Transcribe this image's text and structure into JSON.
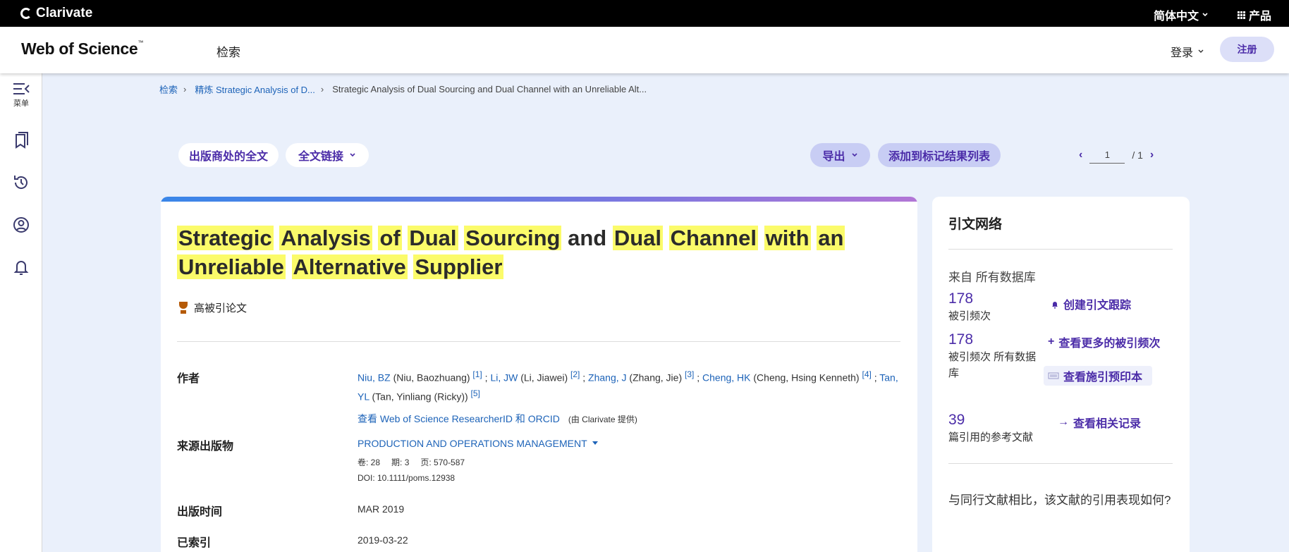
{
  "topbar": {
    "brand": "Clarivate",
    "language": "简体中文",
    "products": "产品"
  },
  "header": {
    "logo": "Web of Science",
    "logo_tm": "™",
    "nav_search": "检索",
    "login": "登录",
    "register": "注册"
  },
  "sidebar": {
    "menu_caption": "菜单"
  },
  "breadcrumb": {
    "search": "检索",
    "refine_prefix": "精炼",
    "refine_text": "Strategic Analysis of D...",
    "current": "Strategic Analysis of Dual Sourcing and Dual Channel with an Unreliable Alt..."
  },
  "actions": {
    "publisher_fulltext": "出版商处的全文",
    "fulltext_links": "全文链接",
    "export": "导出",
    "add_to_marked": "添加到标记结果列表"
  },
  "pager": {
    "current": "1",
    "total": "/ 1"
  },
  "record": {
    "title_words": [
      {
        "text": "Strategic",
        "hl": true
      },
      {
        "text": "Analysis",
        "hl": true
      },
      {
        "text": "of",
        "hl": true
      },
      {
        "text": "Dual",
        "hl": true
      },
      {
        "text": "Sourcing",
        "hl": true
      },
      {
        "text": "and",
        "hl": false
      },
      {
        "text": "Dual",
        "hl": true
      },
      {
        "text": "Channel",
        "hl": true
      },
      {
        "text": "with",
        "hl": true
      },
      {
        "text": "an",
        "hl": true
      },
      {
        "text": "Unreliable",
        "hl": true
      },
      {
        "text": "Alternative",
        "hl": true
      },
      {
        "text": "Supplier",
        "hl": true
      }
    ],
    "highly_cited": "高被引论文",
    "label_authors": "作者",
    "authors": [
      {
        "short": "Niu, BZ",
        "full": "(Niu, Baozhuang)",
        "ref": "[1]"
      },
      {
        "short": "Li, JW",
        "full": "(Li, Jiawei)",
        "ref": "[2]"
      },
      {
        "short": "Zhang, J",
        "full": "(Zhang, Jie)",
        "ref": "[3]"
      },
      {
        "short": "Cheng, HK",
        "full": "(Cheng, Hsing Kenneth)",
        "ref": "[4]"
      },
      {
        "short": "Tan, YL",
        "full": "(Tan, Yinliang (Ricky))",
        "ref": "[5]"
      }
    ],
    "researcherid_link": "查看 Web of Science ResearcherID 和 ORCID",
    "researcherid_note": "(由 Clarivate 提供)",
    "label_source": "来源出版物",
    "journal": "PRODUCTION AND OPERATIONS MANAGEMENT",
    "volume": "卷: 28",
    "issue": "期: 3",
    "pages": "页: 570-587",
    "doi": "DOI: 10.1111/poms.12938",
    "label_pubdate": "出版时间",
    "pubdate": "MAR 2019",
    "label_indexed": "已索引",
    "indexed": "2019-03-22"
  },
  "citation_network": {
    "title": "引文网络",
    "subtitle": "来自 所有数据库",
    "times_cited": "178",
    "times_cited_label": "被引频次",
    "create_alert": "创建引文跟踪",
    "times_cited_all": "178",
    "times_cited_all_label": "被引频次 所有数据库",
    "more_times_cited": "查看更多的被引频次",
    "view_citing": "查看施引预印本",
    "references": "39",
    "references_label": "篇引用的参考文献",
    "view_related": "查看相关记录",
    "compare_text": "与同行文献相比，该文献的引用表现如何?"
  }
}
